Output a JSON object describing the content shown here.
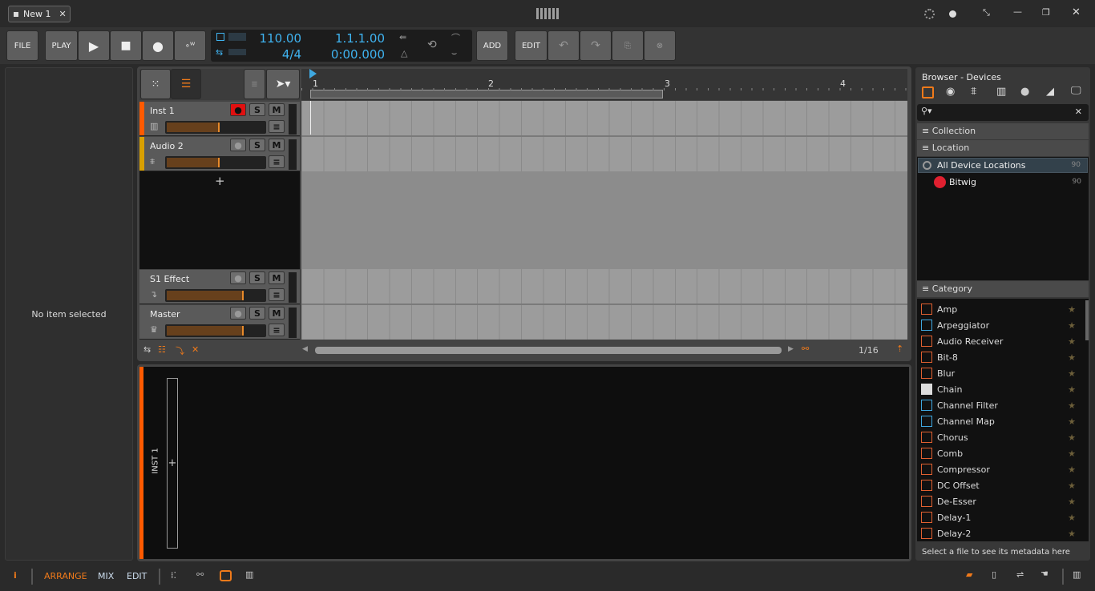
{
  "title_bar": {
    "tab": "New 1"
  },
  "toolbar": {
    "file": "FILE",
    "play": "PLAY",
    "tempo": "110.00",
    "signature": "4/4",
    "position": "1.1.1.00",
    "time": "0:00.000",
    "add": "ADD",
    "edit": "EDIT"
  },
  "inspector": {
    "empty": "No item selected"
  },
  "ruler": {
    "bars": [
      "1",
      "2",
      "3",
      "4"
    ]
  },
  "tracks": [
    {
      "name": "Inst 1",
      "color": "#ff5a00",
      "armed": true
    },
    {
      "name": "Audio 2",
      "color": "#d9a000",
      "armed": false
    },
    {
      "name": "S1 Effect",
      "color": "#5a5a5a",
      "armed": false
    },
    {
      "name": "Master",
      "color": "#5a5a5a",
      "armed": false
    }
  ],
  "track_buttons": {
    "solo": "S",
    "mute": "M"
  },
  "add_track": "+",
  "arranger_footer": {
    "grid": "1/16"
  },
  "device_panel": {
    "track": "INST 1",
    "add": "+"
  },
  "browser": {
    "title": "Browser - Devices",
    "search_placeholder": "",
    "sections": {
      "collection": "Collection",
      "location": "Location",
      "category": "Category"
    },
    "locations": [
      {
        "name": "All Device Locations",
        "count": "90"
      },
      {
        "name": "Bitwig",
        "count": "90"
      }
    ],
    "categories": [
      {
        "name": "Amp",
        "icon": "audio"
      },
      {
        "name": "Arpeggiator",
        "icon": "note"
      },
      {
        "name": "Audio Receiver",
        "icon": "audio"
      },
      {
        "name": "Bit-8",
        "icon": "audio"
      },
      {
        "name": "Blur",
        "icon": "audio"
      },
      {
        "name": "Chain",
        "icon": "container"
      },
      {
        "name": "Channel Filter",
        "icon": "note"
      },
      {
        "name": "Channel Map",
        "icon": "note"
      },
      {
        "name": "Chorus",
        "icon": "audio"
      },
      {
        "name": "Comb",
        "icon": "audio"
      },
      {
        "name": "Compressor",
        "icon": "audio"
      },
      {
        "name": "DC Offset",
        "icon": "audio"
      },
      {
        "name": "De-Esser",
        "icon": "audio"
      },
      {
        "name": "Delay-1",
        "icon": "audio"
      },
      {
        "name": "Delay-2",
        "icon": "audio"
      }
    ],
    "footer": "Select a file to see its metadata here"
  },
  "bottom_bar": {
    "arrange": "ARRANGE",
    "mix": "MIX",
    "edit": "EDIT"
  },
  "colors": {
    "accent": "#f07a1a",
    "lcd": "#3fb3f0",
    "record": "#e01010"
  }
}
